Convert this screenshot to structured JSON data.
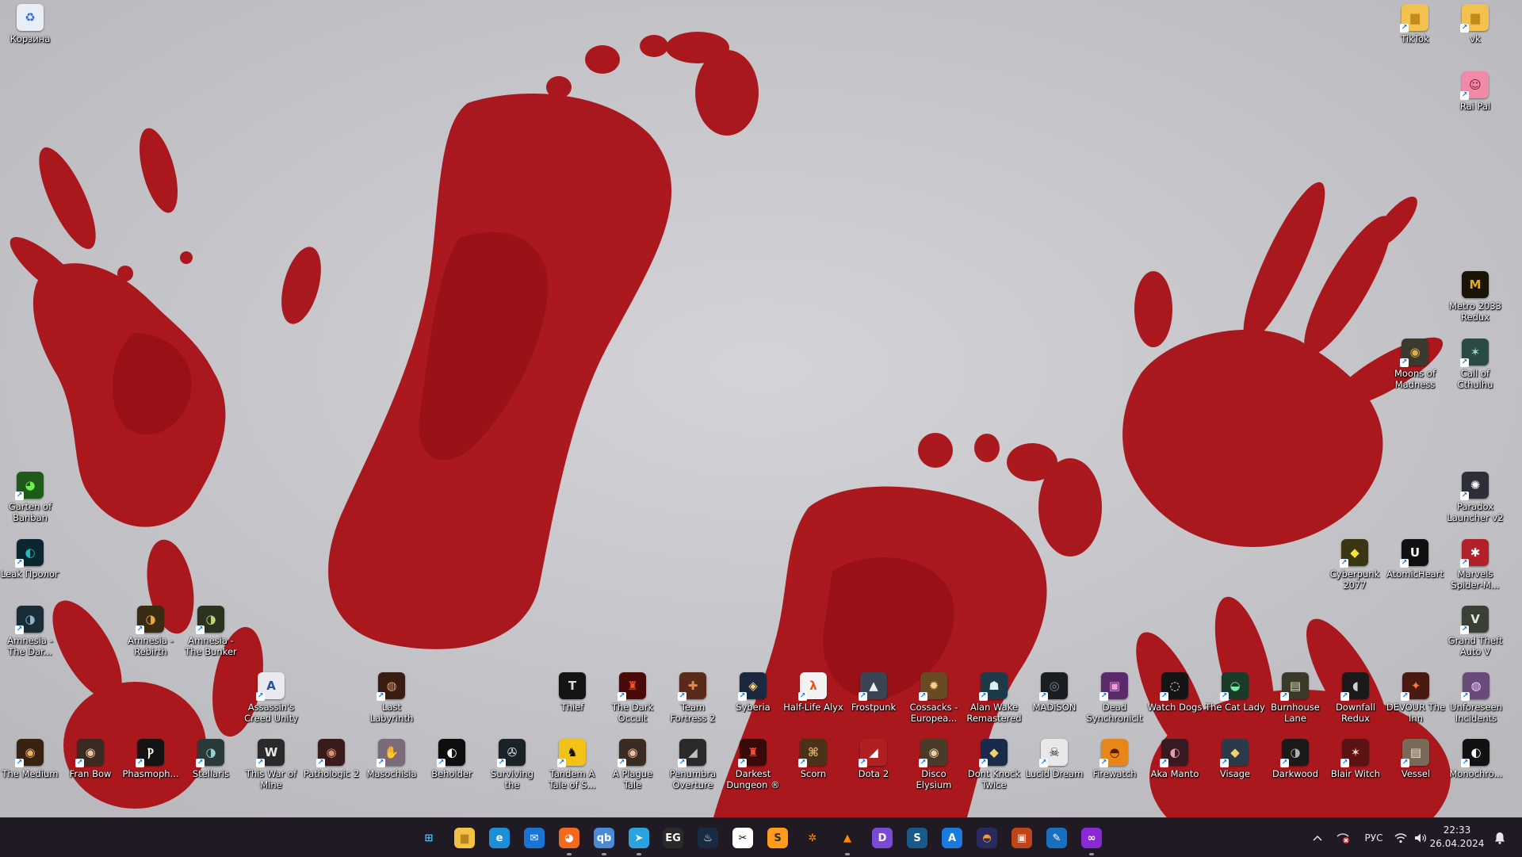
{
  "desktop": {
    "icons": [
      {
        "label": "Корзина",
        "icon": "recycle-bin-icon",
        "color": "#e9eef6",
        "glyph": "♻",
        "fg": "#2b6ad6",
        "shortcut": false
      },
      {
        "label": "TikTok",
        "icon": "folder-icon",
        "color": "#f2c14e",
        "glyph": "▆",
        "fg": "#c48a1c",
        "shortcut": true
      },
      {
        "label": "vk",
        "icon": "folder-icon",
        "color": "#f2c14e",
        "glyph": "▆",
        "fg": "#c48a1c",
        "shortcut": true
      },
      {
        "label": "Rai Pal",
        "icon": "rai-pal-icon",
        "color": "#f08aa8",
        "glyph": "☺",
        "fg": "#7a1030",
        "shortcut": true
      },
      {
        "label": "Metro 2033 Redux",
        "icon": "metro-2033-icon",
        "color": "#1a1408",
        "glyph": "M",
        "fg": "#e0a925",
        "shortcut": false
      },
      {
        "label": "Moons of Madness",
        "icon": "moons-of-madness-icon",
        "color": "#3a3a30",
        "glyph": "◉",
        "fg": "#e2b04a",
        "shortcut": true
      },
      {
        "label": "Call of Cthulhu",
        "icon": "call-of-cthulhu-icon",
        "color": "#2c4a44",
        "glyph": "✶",
        "fg": "#9fd6c0",
        "shortcut": true
      },
      {
        "label": "Garten of Banban",
        "icon": "garten-of-banban-icon",
        "color": "#1f5a1a",
        "glyph": "◕",
        "fg": "#6ef051",
        "shortcut": true
      },
      {
        "label": "Paradox Launcher v2",
        "icon": "paradox-launcher-icon",
        "color": "#2e2e38",
        "glyph": "✺",
        "fg": "#ffffff",
        "shortcut": true
      },
      {
        "label": "Leak Пролог",
        "icon": "leak-prolog-icon",
        "color": "#0c2630",
        "glyph": "◐",
        "fg": "#22b9c4",
        "shortcut": true
      },
      {
        "label": "Cyberpunk 2077",
        "icon": "cyberpunk-2077-icon",
        "color": "#3a3512",
        "glyph": "◆",
        "fg": "#f4e33a",
        "shortcut": true
      },
      {
        "label": "AtomicHeart",
        "icon": "unreal-engine-icon",
        "color": "#111111",
        "glyph": "U",
        "fg": "#ffffff",
        "shortcut": true
      },
      {
        "label": "Marvels Spider-M...",
        "icon": "spider-man-icon",
        "color": "#b2202a",
        "glyph": "✱",
        "fg": "#ffffff",
        "shortcut": true
      },
      {
        "label": "Amnesia - The Dar...",
        "icon": "amnesia-dark-descent-icon",
        "color": "#1a2c38",
        "glyph": "◑",
        "fg": "#8fb6d0",
        "shortcut": true
      },
      {
        "label": "Amnesia - Rebirth",
        "icon": "amnesia-rebirth-icon",
        "color": "#3a2c12",
        "glyph": "◑",
        "fg": "#e8a844",
        "shortcut": true
      },
      {
        "label": "Amnesia - The Bunker",
        "icon": "amnesia-bunker-icon",
        "color": "#2c3220",
        "glyph": "◑",
        "fg": "#c9d07a",
        "shortcut": true
      },
      {
        "label": "Grand Theft Auto V",
        "icon": "gta-v-icon",
        "color": "#3a4034",
        "glyph": "V",
        "fg": "#e8e8e0",
        "shortcut": true
      },
      {
        "label": "Assassin's Creed Unity",
        "icon": "assassins-creed-icon",
        "color": "#e9eaf0",
        "glyph": "A",
        "fg": "#2c4fa0",
        "shortcut": true
      },
      {
        "label": "Last Labyrinth",
        "icon": "last-labyrinth-icon",
        "color": "#3a1c12",
        "glyph": "◍",
        "fg": "#e0a060",
        "shortcut": true
      },
      {
        "label": "Thief",
        "icon": "thief-icon",
        "color": "#141414",
        "glyph": "T",
        "fg": "#dcdcdc",
        "shortcut": false
      },
      {
        "label": "The Dark Occult",
        "icon": "dark-occult-icon",
        "color": "#4a0a0a",
        "glyph": "♜",
        "fg": "#ff4a2a",
        "shortcut": true
      },
      {
        "label": "Team Fortress 2",
        "icon": "team-fortress-icon",
        "color": "#5a2a1a",
        "glyph": "✚",
        "fg": "#f08a3a",
        "shortcut": true
      },
      {
        "label": "Syberia",
        "icon": "syberia-icon",
        "color": "#1c2840",
        "glyph": "◈",
        "fg": "#ffd37a",
        "shortcut": true
      },
      {
        "label": "Half-Life Alyx",
        "icon": "half-life-alyx-icon",
        "color": "#f2f2f2",
        "glyph": "λ",
        "fg": "#e0541c",
        "shortcut": true
      },
      {
        "label": "Frostpunk",
        "icon": "frostpunk-icon",
        "color": "#3a4452",
        "glyph": "▲",
        "fg": "#e8eef6",
        "shortcut": true
      },
      {
        "label": "Cossacks - Europea...",
        "icon": "cossacks-icon",
        "color": "#6a4a22",
        "glyph": "✹",
        "fg": "#f4d08a",
        "shortcut": true
      },
      {
        "label": "Alan Wake Remastered",
        "icon": "alan-wake-icon",
        "color": "#1c3a4a",
        "glyph": "☗",
        "fg": "#dfeef5",
        "shortcut": true
      },
      {
        "label": "MADiSON",
        "icon": "madison-icon",
        "color": "#1a1e22",
        "glyph": "◎",
        "fg": "#7a8a96",
        "shortcut": true
      },
      {
        "label": "Dead Synchronicity",
        "icon": "dead-synchronicity-icon",
        "color": "#5a2a6a",
        "glyph": "▣",
        "fg": "#f09adc",
        "shortcut": true
      },
      {
        "label": "Watch Dogs",
        "icon": "watch-dogs-icon",
        "color": "#141414",
        "glyph": "◌",
        "fg": "#ffffff",
        "shortcut": true
      },
      {
        "label": "The Cat Lady",
        "icon": "cat-lady-icon",
        "color": "#1a3a2a",
        "glyph": "◒",
        "fg": "#7aeaa0",
        "shortcut": true
      },
      {
        "label": "Burnhouse Lane",
        "icon": "burnhouse-lane-icon",
        "color": "#3a3a2a",
        "glyph": "▤",
        "fg": "#e0dcb0",
        "shortcut": true
      },
      {
        "label": "Downfall Redux",
        "icon": "downfall-redux-icon",
        "color": "#1a1a1a",
        "glyph": "◖",
        "fg": "#d0d0d0",
        "shortcut": true
      },
      {
        "label": "DEVOUR The Inn",
        "icon": "devour-icon",
        "color": "#4a1a12",
        "glyph": "✦",
        "fg": "#ff7a3a",
        "shortcut": true
      },
      {
        "label": "Unforeseen Incidents",
        "icon": "unforeseen-incidents-icon",
        "color": "#6a4a7a",
        "glyph": "◍",
        "fg": "#f2d2ff",
        "shortcut": true
      },
      {
        "label": "The Medium",
        "icon": "the-medium-icon",
        "color": "#3a2212",
        "glyph": "◉",
        "fg": "#f0b060",
        "shortcut": true
      },
      {
        "label": "Fran Bow",
        "icon": "fran-bow-icon",
        "color": "#3a2a22",
        "glyph": "◉",
        "fg": "#f0c8a0",
        "shortcut": true
      },
      {
        "label": "Phasmoph...",
        "icon": "phasmophobia-icon",
        "color": "#141414",
        "glyph": "Ⲣ",
        "fg": "#ffffff",
        "shortcut": true
      },
      {
        "label": "Stellaris",
        "icon": "stellaris-icon",
        "color": "#2a3a3a",
        "glyph": "◑",
        "fg": "#9ad0d0",
        "shortcut": true
      },
      {
        "label": "This War of Mine",
        "icon": "this-war-of-mine-icon",
        "color": "#2a2a2a",
        "glyph": "W",
        "fg": "#e8e8e8",
        "shortcut": true
      },
      {
        "label": "Pathologic 2",
        "icon": "pathologic-icon",
        "color": "#3a1a1a",
        "glyph": "◉",
        "fg": "#e09070",
        "shortcut": true
      },
      {
        "label": "Masochisia",
        "icon": "masochisia-icon",
        "color": "#7a6a7a",
        "glyph": "✋",
        "fg": "#f0e0f0",
        "shortcut": true
      },
      {
        "label": "Beholder",
        "icon": "beholder-icon",
        "color": "#0e0e0e",
        "glyph": "◐",
        "fg": "#ffffff",
        "shortcut": true
      },
      {
        "label": "Surviving the Aftermath",
        "icon": "surviving-aftermath-icon",
        "color": "#1a2228",
        "glyph": "✇",
        "fg": "#e0e6ea",
        "shortcut": true
      },
      {
        "label": "Tandem A Tale of S...",
        "icon": "tandem-icon",
        "color": "#f2c21a",
        "glyph": "♞",
        "fg": "#111111",
        "shortcut": true
      },
      {
        "label": "A Plague Tale Requiem",
        "icon": "plague-tale-icon",
        "color": "#3a2c22",
        "glyph": "◉",
        "fg": "#f0c0a0",
        "shortcut": true
      },
      {
        "label": "Penumbra Overture",
        "icon": "penumbra-icon",
        "color": "#2a2a2a",
        "glyph": "◢",
        "fg": "#c0c0c0",
        "shortcut": true
      },
      {
        "label": "Darkest Dungeon ®",
        "icon": "darkest-dungeon-icon",
        "color": "#3a0a0a",
        "glyph": "♜",
        "fg": "#ff5030",
        "shortcut": true
      },
      {
        "label": "Scorn",
        "icon": "scorn-icon",
        "color": "#4a3218",
        "glyph": "⌘",
        "fg": "#e0b070",
        "shortcut": true
      },
      {
        "label": "Dota 2",
        "icon": "dota-2-icon",
        "color": "#b02020",
        "glyph": "◢",
        "fg": "#ffffff",
        "shortcut": true
      },
      {
        "label": "Disco Elysium",
        "icon": "disco-elysium-icon",
        "color": "#4a3a2a",
        "glyph": "◉",
        "fg": "#f0d0a0",
        "shortcut": true
      },
      {
        "label": "Dont Knock Twice",
        "icon": "dont-knock-twice-icon",
        "color": "#1a2a4a",
        "glyph": "◆",
        "fg": "#f0d070",
        "shortcut": true
      },
      {
        "label": "Lucid Dream",
        "icon": "lucid-dream-icon",
        "color": "#e8e8e8",
        "glyph": "☠",
        "fg": "#111111",
        "shortcut": true
      },
      {
        "label": "Firewatch",
        "icon": "firewatch-icon",
        "color": "#e8861a",
        "glyph": "◓",
        "fg": "#5a1a0a",
        "shortcut": true
      },
      {
        "label": "Aka Manto",
        "icon": "aka-manto-icon",
        "color": "#3a1a22",
        "glyph": "◐",
        "fg": "#e0a0b0",
        "shortcut": true
      },
      {
        "label": "Visage",
        "icon": "visage-icon",
        "color": "#2a3a4a",
        "glyph": "◆",
        "fg": "#f0d070",
        "shortcut": true
      },
      {
        "label": "Darkwood",
        "icon": "darkwood-icon",
        "color": "#1a1a1a",
        "glyph": "◑",
        "fg": "#b0b0b0",
        "shortcut": true
      },
      {
        "label": "Blair Witch",
        "icon": "blair-witch-icon",
        "color": "#5a1212",
        "glyph": "✶",
        "fg": "#ffd0d0",
        "shortcut": true
      },
      {
        "label": "Vessel",
        "icon": "vessel-icon",
        "color": "#7a6a5a",
        "glyph": "▤",
        "fg": "#f0e0d0",
        "shortcut": true
      },
      {
        "label": "Monochro...",
        "icon": "monochrome-icon",
        "color": "#111111",
        "glyph": "◐",
        "fg": "#ffffff",
        "shortcut": true
      }
    ]
  },
  "taskbar": {
    "apps": [
      {
        "icon": "start-windows-icon",
        "color": "#201a24",
        "glyph": "⊞",
        "fg": "#4cc2ff",
        "running": false
      },
      {
        "icon": "file-explorer-icon",
        "color": "#f3c145",
        "glyph": "▆",
        "fg": "#b8861c",
        "running": false
      },
      {
        "icon": "edge-browser-icon",
        "color": "#1d8fd8",
        "glyph": "e",
        "fg": "#ffffff",
        "running": false
      },
      {
        "icon": "mail-icon",
        "color": "#1a74d6",
        "glyph": "✉",
        "fg": "#ffffff",
        "running": false
      },
      {
        "icon": "firefox-icon",
        "color": "#f26b1d",
        "glyph": "◕",
        "fg": "#ffffff",
        "running": true
      },
      {
        "icon": "qbittorrent-icon",
        "color": "#4a8ad6",
        "glyph": "qb",
        "fg": "#ffffff",
        "running": true
      },
      {
        "icon": "telegram-icon",
        "color": "#2aa3e0",
        "glyph": "➤",
        "fg": "#ffffff",
        "running": true
      },
      {
        "icon": "epic-games-icon",
        "color": "#2a2a2a",
        "glyph": "EG",
        "fg": "#ffffff",
        "running": false
      },
      {
        "icon": "steam-icon",
        "color": "#1a2a44",
        "glyph": "♨",
        "fg": "#ffffff",
        "running": false
      },
      {
        "icon": "capcut-icon",
        "color": "#ffffff",
        "glyph": "✂",
        "fg": "#111111",
        "running": false
      },
      {
        "icon": "sublime-text-icon",
        "color": "#ff9a1a",
        "glyph": "S",
        "fg": "#2a2a2a",
        "running": false
      },
      {
        "icon": "butterfly-icon",
        "color": "#201a24",
        "glyph": "✲",
        "fg": "#ff8a1a",
        "running": false
      },
      {
        "icon": "vlc-icon",
        "color": "#201a24",
        "glyph": "▲",
        "fg": "#ff8a00",
        "running": true
      },
      {
        "icon": "drawboard-icon",
        "color": "#7a4ad6",
        "glyph": "D",
        "fg": "#ffffff",
        "running": false
      },
      {
        "icon": "s-app-icon",
        "color": "#1a5a8a",
        "glyph": "S",
        "fg": "#ffffff",
        "running": false
      },
      {
        "icon": "app-store-icon",
        "color": "#1a7ae0",
        "glyph": "A",
        "fg": "#ffffff",
        "running": false
      },
      {
        "icon": "gamepad-launcher-icon",
        "color": "#2a2a60",
        "glyph": "◓",
        "fg": "#ff9a2a",
        "running": false
      },
      {
        "icon": "presentation-icon",
        "color": "#c0441a",
        "glyph": "▣",
        "fg": "#ffe0d0",
        "running": false
      },
      {
        "icon": "feather-app-icon",
        "color": "#1a70c0",
        "glyph": "✎",
        "fg": "#ffffff",
        "running": false
      },
      {
        "icon": "discord-like-icon",
        "color": "#8a2ad6",
        "glyph": "∞",
        "fg": "#ffffff",
        "running": true
      }
    ],
    "tray": {
      "language": "РУС",
      "time": "22:33",
      "date": "26.04.2024"
    }
  }
}
